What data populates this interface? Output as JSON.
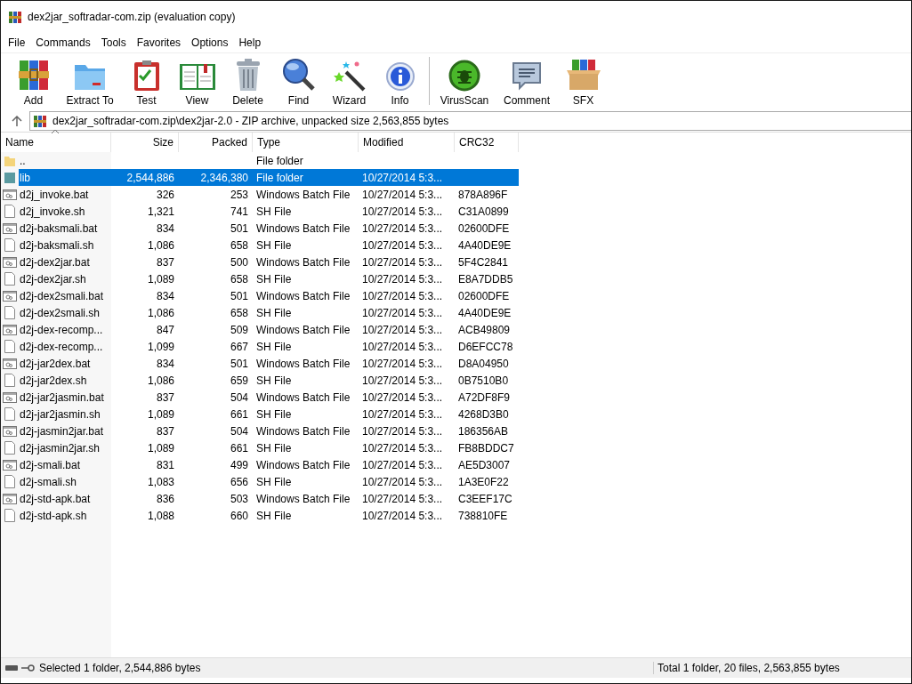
{
  "window": {
    "title": "dex2jar_softradar-com.zip (evaluation copy)"
  },
  "menu": [
    "File",
    "Commands",
    "Tools",
    "Favorites",
    "Options",
    "Help"
  ],
  "toolbar": {
    "groups": [
      [
        {
          "label": "Add",
          "kind": "add"
        },
        {
          "label": "Extract To",
          "kind": "extract"
        },
        {
          "label": "Test",
          "kind": "test"
        },
        {
          "label": "View",
          "kind": "view"
        },
        {
          "label": "Delete",
          "kind": "delete"
        },
        {
          "label": "Find",
          "kind": "find"
        },
        {
          "label": "Wizard",
          "kind": "wizard"
        },
        {
          "label": "Info",
          "kind": "info"
        }
      ],
      [
        {
          "label": "VirusScan",
          "kind": "virus"
        },
        {
          "label": "Comment",
          "kind": "comment"
        },
        {
          "label": "SFX",
          "kind": "sfx"
        }
      ]
    ]
  },
  "address": {
    "path": "dex2jar_softradar-com.zip\\dex2jar-2.0 - ZIP archive, unpacked size 2,563,855 bytes"
  },
  "table": {
    "columns": [
      "Name",
      "Size",
      "Packed",
      "Type",
      "Modified",
      "CRC32"
    ],
    "rows": [
      {
        "kind": "parent",
        "name": "..",
        "size": "",
        "packed": "",
        "type": "File folder",
        "modified": "",
        "crc": "",
        "selected": false
      },
      {
        "kind": "folder",
        "name": "lib",
        "size": "2,544,886",
        "packed": "2,346,380",
        "type": "File folder",
        "modified": "10/27/2014 5:3...",
        "crc": "",
        "selected": true
      },
      {
        "kind": "bat",
        "name": "d2j_invoke.bat",
        "size": "326",
        "packed": "253",
        "type": "Windows Batch File",
        "modified": "10/27/2014 5:3...",
        "crc": "878A896F",
        "selected": false
      },
      {
        "kind": "sh",
        "name": "d2j_invoke.sh",
        "size": "1,321",
        "packed": "741",
        "type": "SH File",
        "modified": "10/27/2014 5:3...",
        "crc": "C31A0899",
        "selected": false
      },
      {
        "kind": "bat",
        "name": "d2j-baksmali.bat",
        "size": "834",
        "packed": "501",
        "type": "Windows Batch File",
        "modified": "10/27/2014 5:3...",
        "crc": "02600DFE",
        "selected": false
      },
      {
        "kind": "sh",
        "name": "d2j-baksmali.sh",
        "size": "1,086",
        "packed": "658",
        "type": "SH File",
        "modified": "10/27/2014 5:3...",
        "crc": "4A40DE9E",
        "selected": false
      },
      {
        "kind": "bat",
        "name": "d2j-dex2jar.bat",
        "size": "837",
        "packed": "500",
        "type": "Windows Batch File",
        "modified": "10/27/2014 5:3...",
        "crc": "5F4C2841",
        "selected": false
      },
      {
        "kind": "sh",
        "name": "d2j-dex2jar.sh",
        "size": "1,089",
        "packed": "658",
        "type": "SH File",
        "modified": "10/27/2014 5:3...",
        "crc": "E8A7DDB5",
        "selected": false
      },
      {
        "kind": "bat",
        "name": "d2j-dex2smali.bat",
        "size": "834",
        "packed": "501",
        "type": "Windows Batch File",
        "modified": "10/27/2014 5:3...",
        "crc": "02600DFE",
        "selected": false
      },
      {
        "kind": "sh",
        "name": "d2j-dex2smali.sh",
        "size": "1,086",
        "packed": "658",
        "type": "SH File",
        "modified": "10/27/2014 5:3...",
        "crc": "4A40DE9E",
        "selected": false
      },
      {
        "kind": "bat",
        "name": "d2j-dex-recomp...",
        "size": "847",
        "packed": "509",
        "type": "Windows Batch File",
        "modified": "10/27/2014 5:3...",
        "crc": "ACB49809",
        "selected": false
      },
      {
        "kind": "sh",
        "name": "d2j-dex-recomp...",
        "size": "1,099",
        "packed": "667",
        "type": "SH File",
        "modified": "10/27/2014 5:3...",
        "crc": "D6EFCC78",
        "selected": false
      },
      {
        "kind": "bat",
        "name": "d2j-jar2dex.bat",
        "size": "834",
        "packed": "501",
        "type": "Windows Batch File",
        "modified": "10/27/2014 5:3...",
        "crc": "D8A04950",
        "selected": false
      },
      {
        "kind": "sh",
        "name": "d2j-jar2dex.sh",
        "size": "1,086",
        "packed": "659",
        "type": "SH File",
        "modified": "10/27/2014 5:3...",
        "crc": "0B7510B0",
        "selected": false
      },
      {
        "kind": "bat",
        "name": "d2j-jar2jasmin.bat",
        "size": "837",
        "packed": "504",
        "type": "Windows Batch File",
        "modified": "10/27/2014 5:3...",
        "crc": "A72DF8F9",
        "selected": false
      },
      {
        "kind": "sh",
        "name": "d2j-jar2jasmin.sh",
        "size": "1,089",
        "packed": "661",
        "type": "SH File",
        "modified": "10/27/2014 5:3...",
        "crc": "4268D3B0",
        "selected": false
      },
      {
        "kind": "bat",
        "name": "d2j-jasmin2jar.bat",
        "size": "837",
        "packed": "504",
        "type": "Windows Batch File",
        "modified": "10/27/2014 5:3...",
        "crc": "186356AB",
        "selected": false
      },
      {
        "kind": "sh",
        "name": "d2j-jasmin2jar.sh",
        "size": "1,089",
        "packed": "661",
        "type": "SH File",
        "modified": "10/27/2014 5:3...",
        "crc": "FB8BDDC7",
        "selected": false
      },
      {
        "kind": "bat",
        "name": "d2j-smali.bat",
        "size": "831",
        "packed": "499",
        "type": "Windows Batch File",
        "modified": "10/27/2014 5:3...",
        "crc": "AE5D3007",
        "selected": false
      },
      {
        "kind": "sh",
        "name": "d2j-smali.sh",
        "size": "1,083",
        "packed": "656",
        "type": "SH File",
        "modified": "10/27/2014 5:3...",
        "crc": "1A3E0F22",
        "selected": false
      },
      {
        "kind": "bat",
        "name": "d2j-std-apk.bat",
        "size": "836",
        "packed": "503",
        "type": "Windows Batch File",
        "modified": "10/27/2014 5:3...",
        "crc": "C3EEF17C",
        "selected": false
      },
      {
        "kind": "sh",
        "name": "d2j-std-apk.sh",
        "size": "1,088",
        "packed": "660",
        "type": "SH File",
        "modified": "10/27/2014 5:3...",
        "crc": "738810FE",
        "selected": false
      }
    ]
  },
  "status_bar": {
    "left": "Selected 1 folder, 2,544,886 bytes",
    "right": "Total 1 folder, 20 files, 2,563,855 bytes"
  }
}
